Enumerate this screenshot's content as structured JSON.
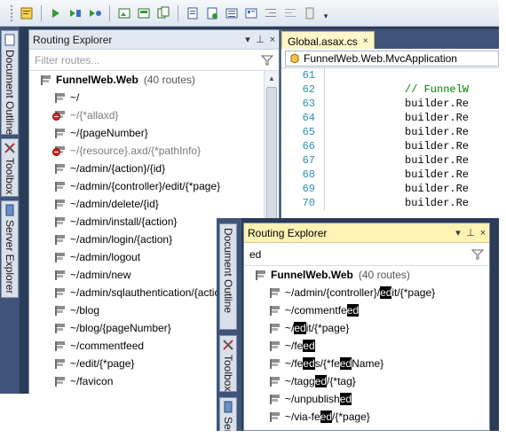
{
  "toolbar": {
    "buttons": [
      "comment-icon",
      "run-icon",
      "step-into-icon",
      "step-over-icon",
      "image-icon",
      "save-all-icon",
      "copy-icon",
      "document-icon",
      "properties-icon",
      "list-icon",
      "outline-icon",
      "indent-icon",
      "outdent-icon",
      "tools-icon"
    ],
    "more_label": "▾"
  },
  "side_tabs": {
    "document_outline": "Document Outline",
    "toolbox": "Toolbox",
    "server_explorer": "Server Explorer"
  },
  "routing_explorer": {
    "title": "Routing Explorer",
    "pin_label": "▾",
    "pin2_label": "⊥",
    "close_label": "×",
    "filter_placeholder": "Filter routes...",
    "root_name": "FunnelWeb.Web",
    "root_count": "(40 routes)",
    "routes": [
      {
        "label": "~/",
        "ignored": false
      },
      {
        "label": "~/{*allaxd}",
        "ignored": true
      },
      {
        "label": "~/{pageNumber}",
        "ignored": false
      },
      {
        "label": "~/{resource}.axd/{*pathInfo}",
        "ignored": true
      },
      {
        "label": "~/admin/{action}/{id}",
        "ignored": false
      },
      {
        "label": "~/admin/{controller}/edit/{*page}",
        "ignored": false
      },
      {
        "label": "~/admin/delete/{id}",
        "ignored": false
      },
      {
        "label": "~/admin/install/{action}",
        "ignored": false
      },
      {
        "label": "~/admin/login/{action}",
        "ignored": false
      },
      {
        "label": "~/admin/logout",
        "ignored": false
      },
      {
        "label": "~/admin/new",
        "ignored": false
      },
      {
        "label": "~/admin/sqlauthentication/{action}",
        "ignored": false
      },
      {
        "label": "~/blog",
        "ignored": false
      },
      {
        "label": "~/blog/{pageNumber}",
        "ignored": false
      },
      {
        "label": "~/commentfeed",
        "ignored": false
      },
      {
        "label": "~/edit/{*page}",
        "ignored": false
      },
      {
        "label": "~/favicon",
        "ignored": false
      }
    ]
  },
  "editor": {
    "tab_label": "Global.asax.cs",
    "tab_close": "×",
    "nav_label": "FunnelWeb.Web.MvcApplication",
    "lines": [
      {
        "num": "61",
        "text": "",
        "comment": false
      },
      {
        "num": "62",
        "text": "// FunnelW",
        "comment": true
      },
      {
        "num": "63",
        "text": "builder.Re",
        "comment": false
      },
      {
        "num": "64",
        "text": "builder.Re",
        "comment": false
      },
      {
        "num": "65",
        "text": "builder.Re",
        "comment": false
      },
      {
        "num": "66",
        "text": "builder.Re",
        "comment": false
      },
      {
        "num": "67",
        "text": "builder.Re",
        "comment": false
      },
      {
        "num": "68",
        "text": "builder.Re",
        "comment": false
      },
      {
        "num": "69",
        "text": "builder.Re",
        "comment": false
      },
      {
        "num": "70",
        "text": "builder.Re",
        "comment": false
      }
    ]
  },
  "front": {
    "title": "Routing Explorer",
    "filter_value": "ed",
    "root_name": "FunnelWeb.Web",
    "root_count": "(40 routes)",
    "side_tabs": {
      "document_outline": "Document Outline",
      "toolbox": "Toolbox",
      "server": "Server"
    },
    "routes": [
      {
        "parts": [
          [
            "~/admin/{controller}/",
            false
          ],
          [
            "ed",
            true
          ],
          [
            "it/{*page}",
            false
          ]
        ]
      },
      {
        "parts": [
          [
            "~/commentfe",
            false
          ],
          [
            "ed",
            true
          ]
        ]
      },
      {
        "parts": [
          [
            "~/",
            false
          ],
          [
            "ed",
            true
          ],
          [
            "it/{*page}",
            false
          ]
        ]
      },
      {
        "parts": [
          [
            "~/fe",
            false
          ],
          [
            "ed",
            true
          ]
        ]
      },
      {
        "parts": [
          [
            "~/fe",
            false
          ],
          [
            "ed",
            true
          ],
          [
            "s/{*fe",
            false
          ],
          [
            "ed",
            true
          ],
          [
            "Name}",
            false
          ]
        ]
      },
      {
        "parts": [
          [
            "~/tagg",
            false
          ],
          [
            "ed",
            true
          ],
          [
            "/{*tag}",
            false
          ]
        ]
      },
      {
        "parts": [
          [
            "~/unpublish",
            false
          ],
          [
            "ed",
            true
          ]
        ]
      },
      {
        "parts": [
          [
            "~/via-fe",
            false
          ],
          [
            "ed",
            true
          ],
          [
            "/{*page}",
            false
          ]
        ]
      }
    ]
  }
}
